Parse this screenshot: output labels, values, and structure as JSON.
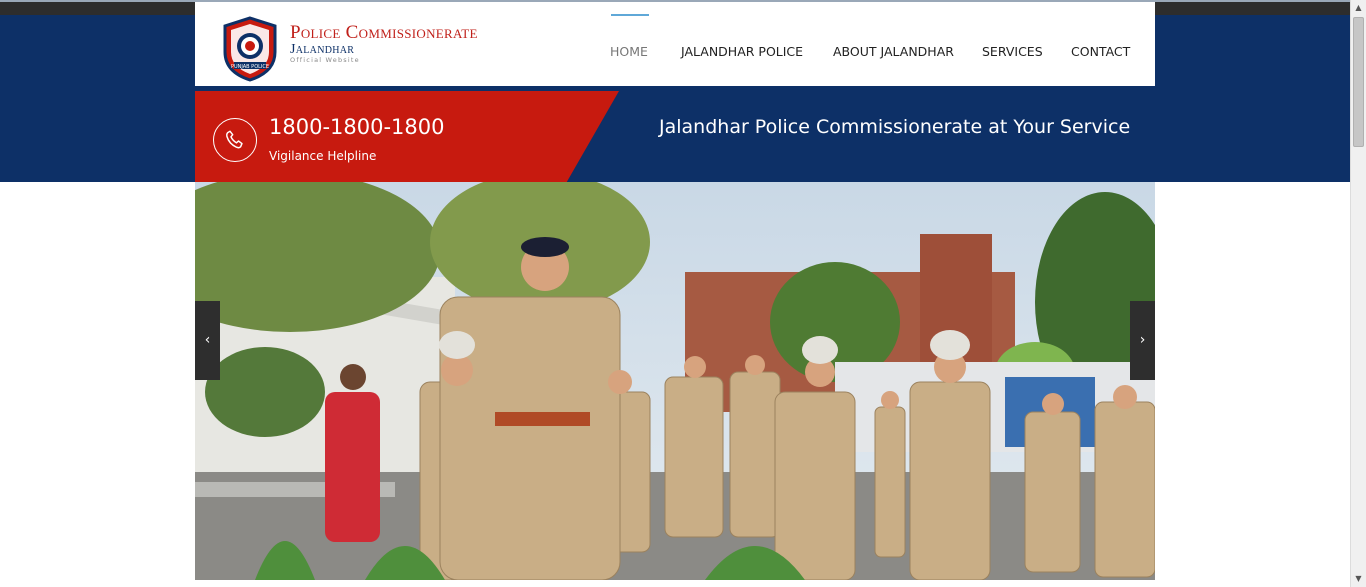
{
  "brand": {
    "title": "Police Commissionerate",
    "city": "Jalandhar",
    "subtitle": "Official Website",
    "badge_text": "PUNJAB POLICE"
  },
  "nav": {
    "items": [
      {
        "label": "HOME",
        "active": true
      },
      {
        "label": "JALANDHAR POLICE",
        "active": false
      },
      {
        "label": "ABOUT JALANDHAR",
        "active": false
      },
      {
        "label": "SERVICES",
        "active": false
      },
      {
        "label": "CONTACT",
        "active": false
      }
    ]
  },
  "helpline": {
    "number": "1800-1800-1800",
    "label": "Vigilance Helpline",
    "icon": "phone-icon"
  },
  "tagline": "Jalandhar Police Commissionerate at Your Service",
  "slider": {
    "prev_label": "‹",
    "next_label": "›",
    "image_description": "Police officers in khaki uniforms saluting outdoors"
  },
  "colors": {
    "navy": "#0d3067",
    "red": "#c71a0f",
    "nav_indicator": "#5fa8d8"
  }
}
